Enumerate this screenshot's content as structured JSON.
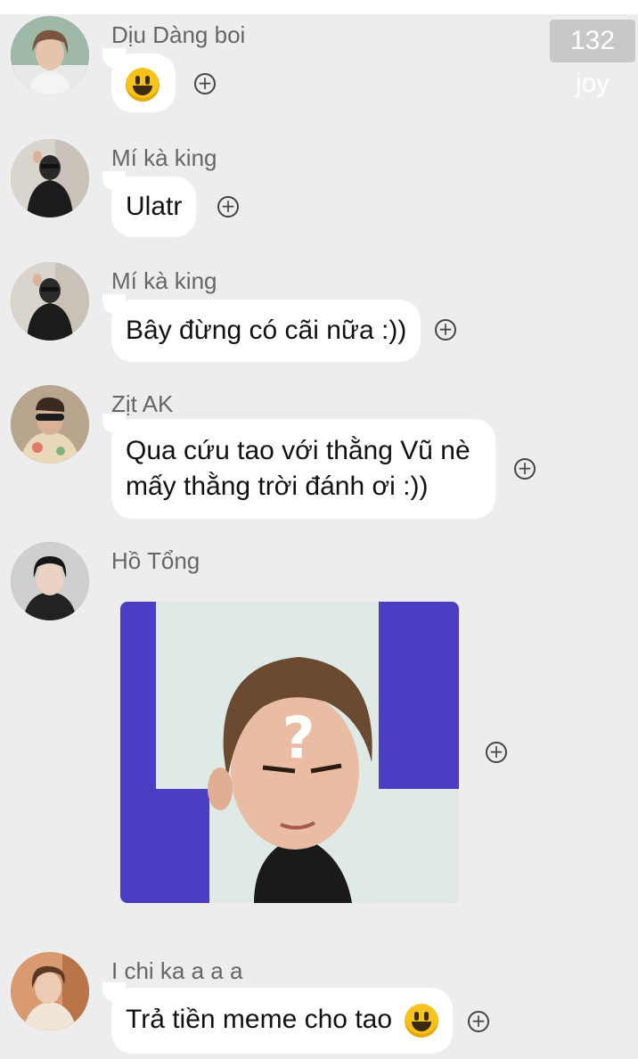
{
  "badge": "132 joy",
  "messages": [
    {
      "sender": "Dịu Dàng boi",
      "emoji": "smiling-face-emoji"
    },
    {
      "sender": "Mí kà king",
      "text": "Ulatr"
    },
    {
      "sender": "Mí kà king",
      "text": "Bây đừng có cãi nữa :))"
    },
    {
      "sender": "Zịt AK",
      "line1": "Qua cứu tao với thằng Vũ nè",
      "line2": "mấy thằng trời đánh ơi :))"
    },
    {
      "sender": "Hồ Tổng",
      "image": "meme-photo-question-mark"
    },
    {
      "sender": "I chi ka a a a",
      "text": "Trả tiền meme cho tao",
      "emoji": "smiling-face-emoji"
    }
  ],
  "react_symbol": "+",
  "meme_overlay": "?",
  "colors": {
    "background": "#ededed",
    "bubble": "#ffffff",
    "name": "#666666",
    "meme_purple": "#4a3fc3"
  }
}
